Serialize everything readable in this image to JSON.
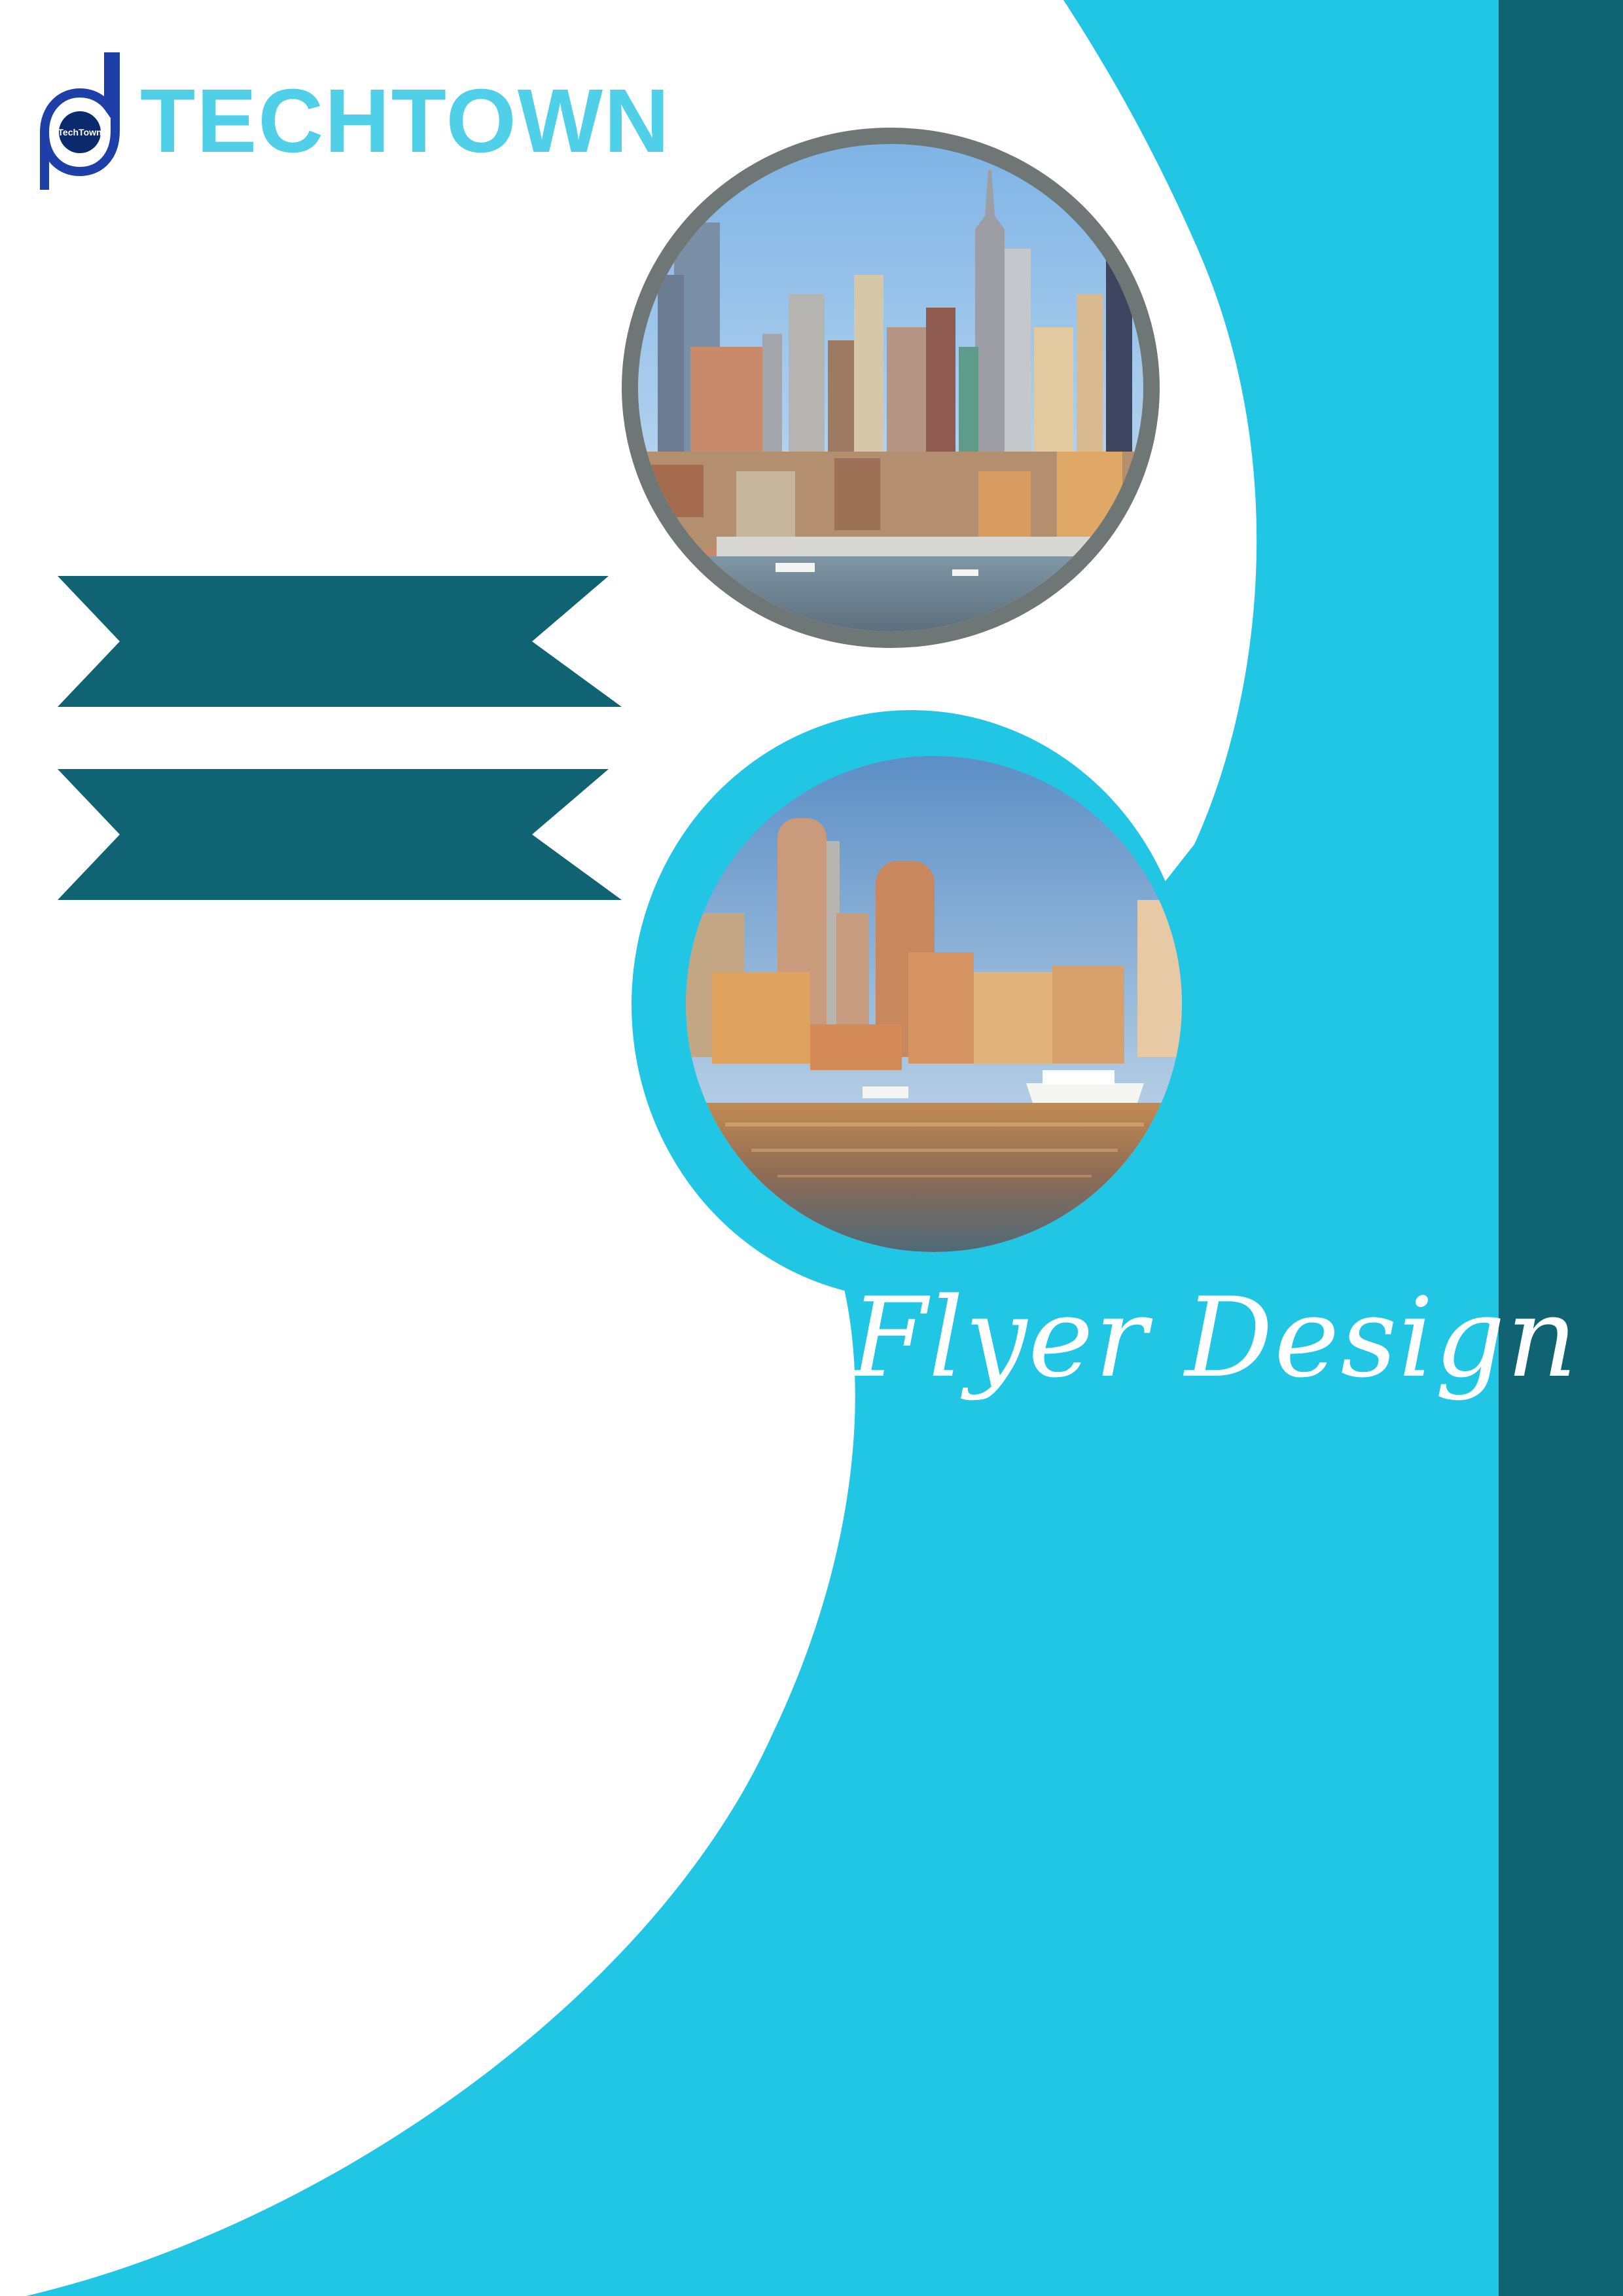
{
  "brand": {
    "name": "TECHTOWN",
    "logo_text": "TechTown",
    "logo_icon": "pd-monogram-icon"
  },
  "flyer": {
    "title": "Flyer Design"
  },
  "colors": {
    "cyan": "#22c6e5",
    "teal": "#0f6373",
    "brand_text": "#4fd0e8",
    "white": "#ffffff",
    "frame_gray": "#6f7676"
  }
}
